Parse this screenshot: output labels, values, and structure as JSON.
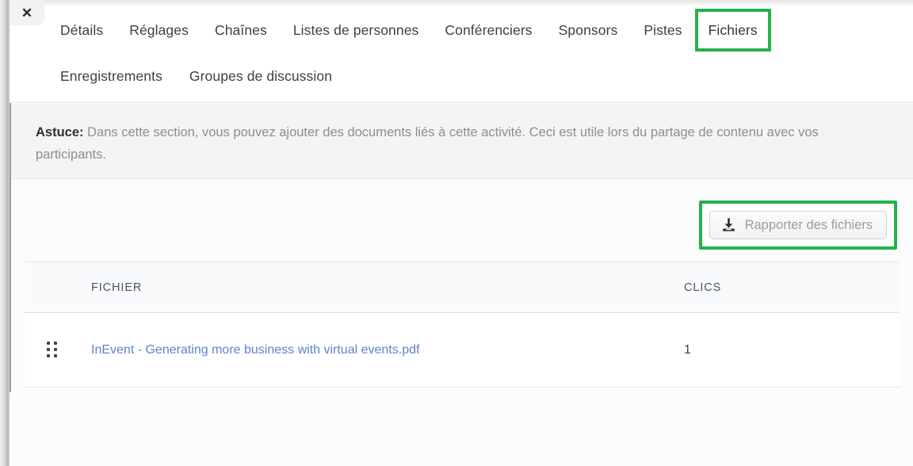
{
  "window": {
    "close_label": "✖"
  },
  "tabs": {
    "row1": [
      {
        "label": "Détails",
        "active": false,
        "highlighted": false
      },
      {
        "label": "Réglages",
        "active": false,
        "highlighted": false
      },
      {
        "label": "Chaînes",
        "active": false,
        "highlighted": false
      },
      {
        "label": "Listes de personnes",
        "active": false,
        "highlighted": false
      },
      {
        "label": "Conférenciers",
        "active": false,
        "highlighted": false
      },
      {
        "label": "Sponsors",
        "active": false,
        "highlighted": false
      },
      {
        "label": "Pistes",
        "active": false,
        "highlighted": false
      },
      {
        "label": "Fichiers",
        "active": true,
        "highlighted": true
      }
    ],
    "row2": [
      {
        "label": "Enregistrements",
        "active": false,
        "highlighted": false
      },
      {
        "label": "Groupes de discussion",
        "active": false,
        "highlighted": false
      }
    ]
  },
  "tip": {
    "label": "Astuce:",
    "text": " Dans cette section, vous pouvez ajouter des documents liés à cette activité. Ceci est utile lors du partage de contenu avec vos participants."
  },
  "toolbar": {
    "import_label": "Rapporter des fichiers",
    "import_icon": "download-icon"
  },
  "table": {
    "columns": [
      "",
      "FICHIER",
      "CLICS"
    ],
    "rows": [
      {
        "handle": "drag-handle-icon",
        "file": "InEvent - Generating more business with virtual events.pdf",
        "clics": "1"
      }
    ]
  },
  "colors": {
    "highlight_green": "#22b24c",
    "active_tab_blue": "#4b90d8",
    "link_blue": "#5b85c8",
    "tip_background": "#f4f4f5",
    "table_header_background": "#f9fafc"
  }
}
